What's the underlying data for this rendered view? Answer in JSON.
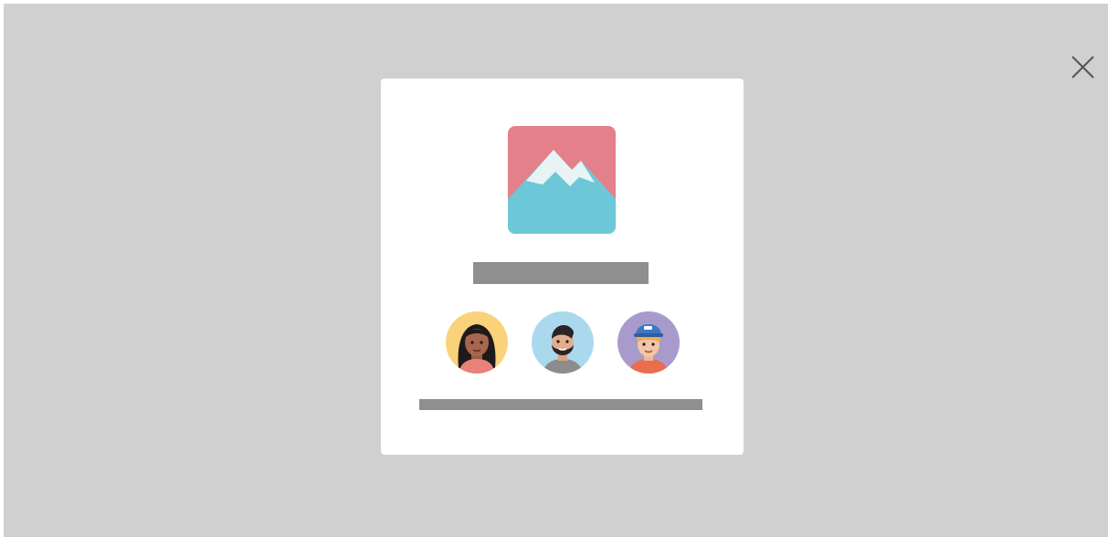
{
  "dialog": {
    "close_icon": "close-icon",
    "hero_icon": "image-placeholder-icon",
    "title_placeholder": "",
    "subtitle_placeholder": "",
    "avatars": [
      {
        "name": "avatar-woman",
        "bg": "#f9d27a"
      },
      {
        "name": "avatar-bearded-man",
        "bg": "#aad9ee"
      },
      {
        "name": "avatar-man-cap",
        "bg": "#a89bcb"
      }
    ]
  },
  "colors": {
    "overlay": "#d0d0d0",
    "card": "#ffffff",
    "placeholder_bar": "#8f8f8f",
    "hero_sky": "#e3808a",
    "hero_mountain": "#6cc8d8",
    "hero_snow": "#e8f3f6"
  }
}
